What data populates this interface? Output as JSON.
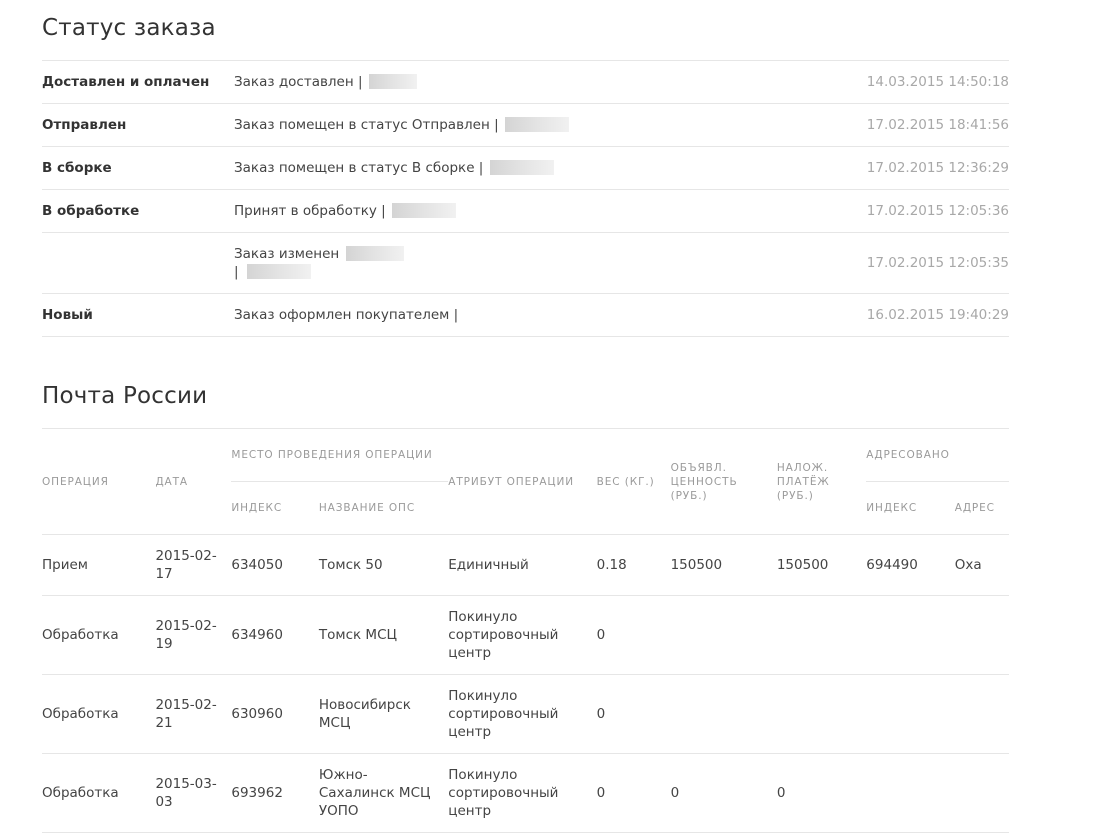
{
  "status": {
    "title": "Статус заказа",
    "rows": [
      {
        "name": "Доставлен и оплачен",
        "desc": "Заказ доставлен |",
        "desc2": "",
        "time": "14.03.2015 14:50:18"
      },
      {
        "name": "Отправлен",
        "desc": "Заказ помещен в статус Отправлен |",
        "desc2": "",
        "time": "17.02.2015 18:41:56"
      },
      {
        "name": "В сборке",
        "desc": "Заказ помещен в статус В сборке |",
        "desc2": "",
        "time": "17.02.2015 12:36:29"
      },
      {
        "name": "В обработке",
        "desc": "Принят в обработку |",
        "desc2": "",
        "time": "17.02.2015 12:05:36"
      },
      {
        "name": "",
        "desc": "Заказ изменен",
        "desc2": "|",
        "time": "17.02.2015 12:05:35"
      },
      {
        "name": "Новый",
        "desc": "Заказ оформлен покупателем |",
        "desc2": "",
        "time": "16.02.2015 19:40:29"
      }
    ]
  },
  "post": {
    "title": "Почта России",
    "headers": {
      "operation": "Операция",
      "date": "Дата",
      "place": "Место проведения операции",
      "index": "Индекс",
      "ops_name": "Название ОПС",
      "attribute": "Атрибут операции",
      "weight": "Вес (кг.)",
      "declared": "Объявл. ценность (руб.)",
      "cod": "Налож. платёж (руб.)",
      "addressed": "Адресовано",
      "addr_index": "Индекс",
      "address": "Адрес"
    },
    "rows": [
      {
        "operation": "Прием",
        "date": "2015-02-17",
        "index": "634050",
        "ops_name": "Томск 50",
        "attribute": "Единичный",
        "weight": "0.18",
        "declared": "150500",
        "cod": "150500",
        "addr_index": "694490",
        "address": "Оха"
      },
      {
        "operation": "Обработка",
        "date": "2015-02-19",
        "index": "634960",
        "ops_name": "Томск МСЦ",
        "attribute": "Покинуло сортировочный центр",
        "weight": "0",
        "declared": "",
        "cod": "",
        "addr_index": "",
        "address": ""
      },
      {
        "operation": "Обработка",
        "date": "2015-02-21",
        "index": "630960",
        "ops_name": "Новосибирск МСЦ",
        "attribute": "Покинуло сортировочный центр",
        "weight": "0",
        "declared": "",
        "cod": "",
        "addr_index": "",
        "address": ""
      },
      {
        "operation": "Обработка",
        "date": "2015-03-03",
        "index": "693962",
        "ops_name": "Южно-Сахалинск МСЦ УОПО",
        "attribute": "Покинуло сортировочный центр",
        "weight": "0",
        "declared": "0",
        "cod": "0",
        "addr_index": "",
        "address": ""
      }
    ]
  }
}
